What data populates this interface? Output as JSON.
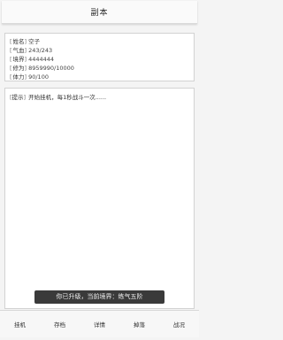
{
  "header": {
    "title": "副本"
  },
  "stats": [
    {
      "label": "姓名",
      "value": "空子"
    },
    {
      "label": "气血",
      "value": "243/243"
    },
    {
      "label": "境界",
      "value": "4444444"
    },
    {
      "label": "修为",
      "value": "8959990/10000"
    },
    {
      "label": "体力",
      "value": "90/100"
    }
  ],
  "log": {
    "label": "提示",
    "message": "开始挂机，每1秒战斗一次......"
  },
  "toast": {
    "text": "你已升级，当前境界：练气五阶"
  },
  "tabs": [
    {
      "label": "挂机"
    },
    {
      "label": "存档"
    },
    {
      "label": "详情"
    },
    {
      "label": "掉落"
    },
    {
      "label": "战况"
    }
  ],
  "colors": {
    "background": "#f4f4f4",
    "panel": "#ffffff",
    "toast_bg": "#3a3a3a"
  }
}
